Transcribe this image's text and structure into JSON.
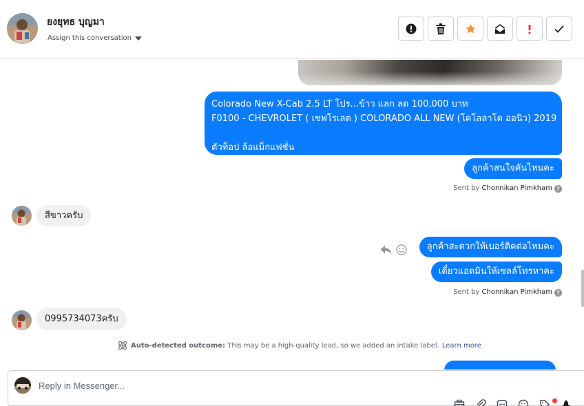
{
  "header": {
    "contact_name": "ยงยุทธ บุญมา",
    "assign_label": "Assign this conversation",
    "actions": [
      {
        "name": "spam-button",
        "icon": "alert-circle-icon"
      },
      {
        "name": "delete-button",
        "icon": "trash-icon"
      },
      {
        "name": "star-button",
        "icon": "star-icon",
        "color": "#f7923b"
      },
      {
        "name": "mark-unread-button",
        "icon": "envelope-icon"
      },
      {
        "name": "follow-up-button",
        "icon": "exclamation-icon",
        "color": "#fa383e"
      },
      {
        "name": "mark-done-button",
        "icon": "checkmark-icon"
      }
    ]
  },
  "messages": {
    "big": {
      "line1": "Colorado New X-Cab 2.5 LT โปร...ข้าว แลก ลด 100,000 บาท",
      "line2": "F0100 - CHEVROLET ( เชฟโรเลต ) COLORADO ALL NEW (โคโลลาโด ออนิว) 2019",
      "line3": "",
      "line4": "ตัวท็อป ล้อแม็กแฟชั่น"
    },
    "out2": "ลูกค้าสนใจคันไหนคะ",
    "sent1_prefix": "Sent by ",
    "sent1_name": "Chonnikan Pimkham",
    "in1": "สีขาวครับ",
    "out3": "ลูกค้าสะดวกให้เบอร์ติดต่อไหมคะ",
    "out4": "เดี๋ยวแอดมินให้เซลล์โทรหาคะ",
    "sent2_prefix": "Sent by ",
    "sent2_name": "Chonnikan Pimkham",
    "in2": "0995734073ครับ",
    "help": "?"
  },
  "outcome": {
    "label": "Auto-detected outcome:",
    "text": " This may be a high-quality lead, so we added an intake label.",
    "link": "Learn more"
  },
  "composer": {
    "placeholder": "Reply in Messenger...",
    "tools": [
      "saved-reply-icon",
      "attachment-icon",
      "chat-icon",
      "emoji-icon",
      "tag-icon",
      "pin-icon"
    ]
  },
  "colors": {
    "outgoing_bubble": "#0a7cff",
    "incoming_bubble": "#f0f0f0",
    "star": "#f7923b",
    "alert": "#fa383e"
  }
}
